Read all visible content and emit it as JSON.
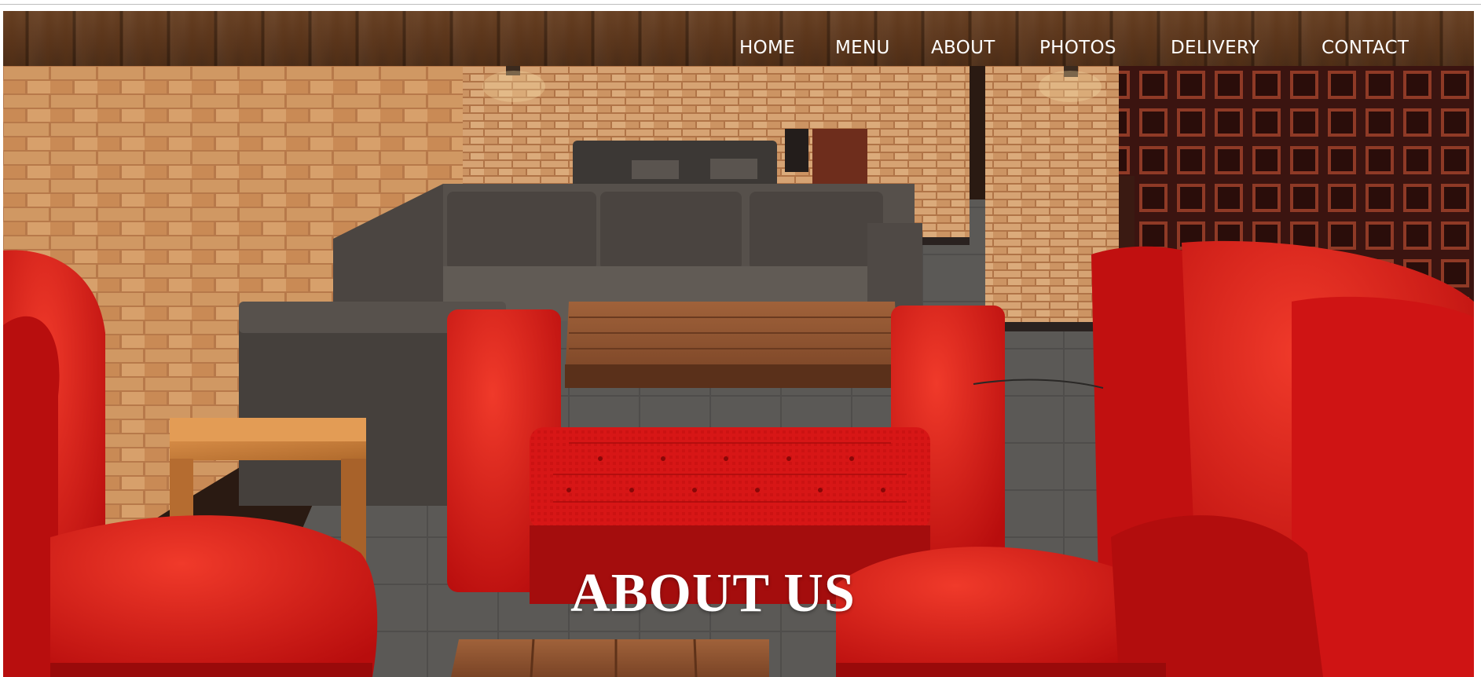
{
  "nav": {
    "items": [
      {
        "label": "HOME"
      },
      {
        "label": "MENU"
      },
      {
        "label": "ABOUT"
      },
      {
        "label": "PHOTOS"
      },
      {
        "label": "DELIVERY"
      },
      {
        "label": "CONTACT"
      }
    ]
  },
  "hero": {
    "title": "ABOUT US"
  },
  "colors": {
    "nav_background": "#5a361d",
    "accent_red": "#d41414",
    "brick": "#c98a55",
    "sofa_grey": "#4a423c",
    "text": "#ffffff"
  }
}
